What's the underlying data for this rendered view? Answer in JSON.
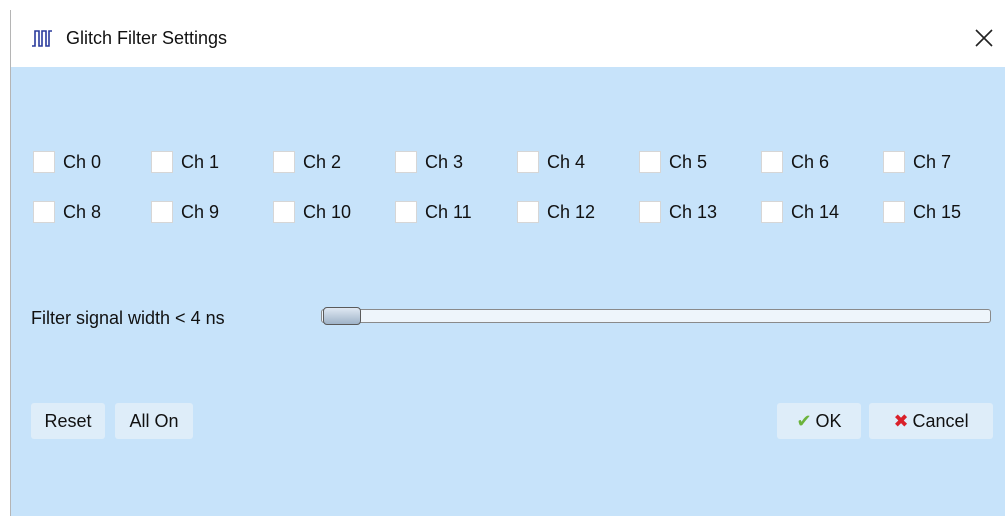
{
  "window": {
    "title": "Glitch Filter Settings",
    "icon": "pulse-waveform-icon"
  },
  "channels": [
    {
      "label": "Ch 0",
      "checked": false
    },
    {
      "label": "Ch 1",
      "checked": false
    },
    {
      "label": "Ch 2",
      "checked": false
    },
    {
      "label": "Ch 3",
      "checked": false
    },
    {
      "label": "Ch 4",
      "checked": false
    },
    {
      "label": "Ch 5",
      "checked": false
    },
    {
      "label": "Ch 6",
      "checked": false
    },
    {
      "label": "Ch 7",
      "checked": false
    },
    {
      "label": "Ch 8",
      "checked": false
    },
    {
      "label": "Ch 9",
      "checked": false
    },
    {
      "label": "Ch 10",
      "checked": false
    },
    {
      "label": "Ch 11",
      "checked": false
    },
    {
      "label": "Ch 12",
      "checked": false
    },
    {
      "label": "Ch 13",
      "checked": false
    },
    {
      "label": "Ch 14",
      "checked": false
    },
    {
      "label": "Ch 15",
      "checked": false
    }
  ],
  "filter": {
    "label": "Filter signal width < 4 ns",
    "slider_value_fraction": 0
  },
  "buttons": {
    "reset": "Reset",
    "all_on": "All On",
    "ok": "OK",
    "cancel": "Cancel"
  },
  "colors": {
    "dialog_background": "#c7e3fa",
    "ok_check": "#6bb33c",
    "cancel_x": "#d9202a",
    "title_icon": "#2a3a9c"
  }
}
